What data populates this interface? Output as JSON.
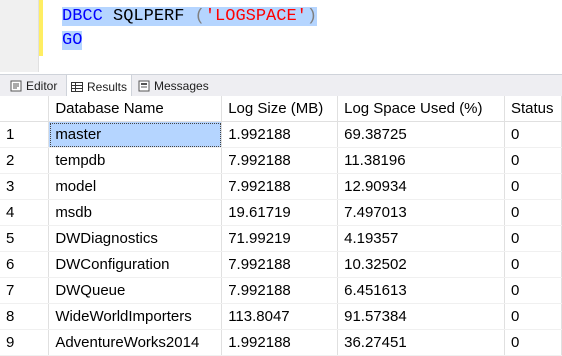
{
  "editor": {
    "line1": {
      "kw": "DBCC",
      "space1": " ",
      "name": "SQLPERF",
      "space2": " ",
      "lparen": "(",
      "arg": "'LOGSPACE'",
      "rparen": ")"
    },
    "line2": {
      "kw": "GO"
    }
  },
  "tabs": [
    {
      "label": "Editor",
      "icon": "editor-icon"
    },
    {
      "label": "Results",
      "icon": "grid-icon"
    },
    {
      "label": "Messages",
      "icon": "messages-icon"
    }
  ],
  "grid": {
    "columns": [
      "Database Name",
      "Log Size (MB)",
      "Log Space Used (%)",
      "Status"
    ],
    "rows": [
      {
        "n": "1",
        "name": "master",
        "size": "1.992188",
        "used": "69.38725",
        "status": "0"
      },
      {
        "n": "2",
        "name": "tempdb",
        "size": "7.992188",
        "used": "11.38196",
        "status": "0"
      },
      {
        "n": "3",
        "name": "model",
        "size": "7.992188",
        "used": "12.90934",
        "status": "0"
      },
      {
        "n": "4",
        "name": "msdb",
        "size": "19.61719",
        "used": "7.497013",
        "status": "0"
      },
      {
        "n": "5",
        "name": "DWDiagnostics",
        "size": "71.99219",
        "used": "4.19357",
        "status": "0"
      },
      {
        "n": "6",
        "name": "DWConfiguration",
        "size": "7.992188",
        "used": "10.32502",
        "status": "0"
      },
      {
        "n": "7",
        "name": "DWQueue",
        "size": "7.992188",
        "used": "6.451613",
        "status": "0"
      },
      {
        "n": "8",
        "name": "WideWorldImporters",
        "size": "113.8047",
        "used": "91.57384",
        "status": "0"
      },
      {
        "n": "9",
        "name": "AdventureWorks2014",
        "size": "1.992188",
        "used": "36.27451",
        "status": "0"
      }
    ]
  }
}
